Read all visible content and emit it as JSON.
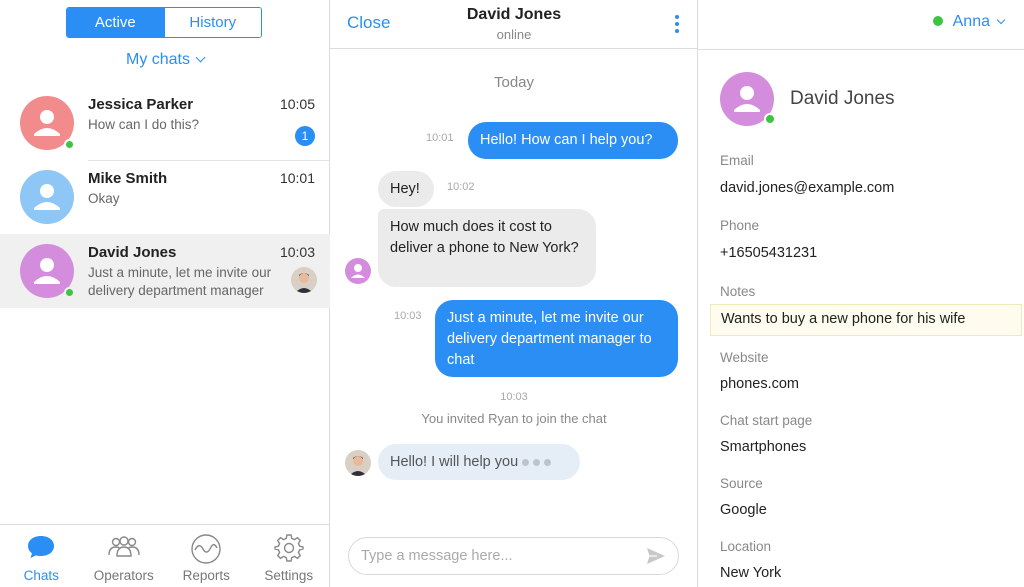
{
  "left": {
    "tabs": {
      "active": "Active",
      "history": "History"
    },
    "filter": "My chats",
    "chats": [
      {
        "name": "Jessica Parker",
        "preview": "How can I do this?",
        "time": "10:05",
        "badge": "1",
        "avatar_color": "#f28b8b"
      },
      {
        "name": "Mike Smith",
        "preview": "Okay",
        "time": "10:01",
        "avatar_color": "#8ec6f5"
      },
      {
        "name": "David Jones",
        "preview": "Just a minute, let me invite our delivery department manager",
        "time": "10:03",
        "avatar_color": "#d38ddc"
      }
    ],
    "nav": [
      {
        "label": "Chats",
        "icon": "chat-bubble-icon"
      },
      {
        "label": "Operators",
        "icon": "operators-icon"
      },
      {
        "label": "Reports",
        "icon": "reports-icon"
      },
      {
        "label": "Settings",
        "icon": "gear-icon"
      }
    ]
  },
  "conversation": {
    "close_label": "Close",
    "contact_name": "David Jones",
    "status": "online",
    "day_label": "Today",
    "messages": [
      {
        "text": "Hello! How can I help you?",
        "time": "10:01"
      },
      {
        "text": "Hey!",
        "time": "10:02"
      },
      {
        "text": "How much does it cost to deliver a phone to New York?"
      },
      {
        "text": "Just a minute, let me invite our delivery department manager to chat",
        "time": "10:03"
      }
    ],
    "system": {
      "time": "10:03",
      "text": "You invited Ryan to join the chat"
    },
    "typing": {
      "text": "Hello! I will help you"
    },
    "composer_placeholder": "Type a message here..."
  },
  "details": {
    "agent": "Anna",
    "name": "David Jones",
    "fields": {
      "email_label": "Email",
      "email": "david.jones@example.com",
      "phone_label": "Phone",
      "phone": "+16505431231",
      "notes_label": "Notes",
      "notes": "Wants to buy a new phone for his wife",
      "website_label": "Website",
      "website": "phones.com",
      "start_page_label": "Chat start page",
      "start_page": "Smartphones",
      "source_label": "Source",
      "source": "Google",
      "location_label": "Location",
      "location": "New York"
    }
  },
  "colors": {
    "accent": "#2a8ef5",
    "online": "#3ec342",
    "incoming_bubble": "#ebebeb",
    "notes_bg": "#fdfcef"
  }
}
